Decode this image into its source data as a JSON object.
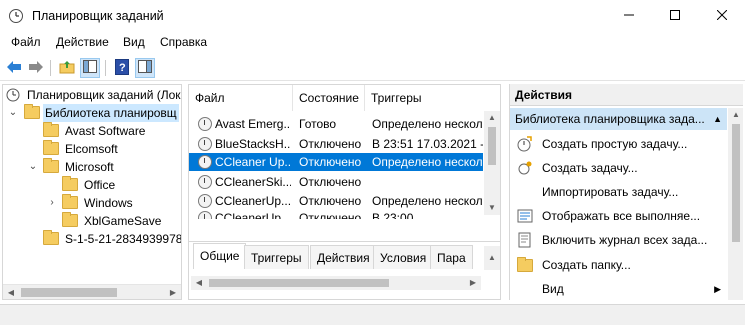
{
  "window": {
    "title": "Планировщик заданий",
    "icons": {
      "app": "task-scheduler-clock-icon",
      "minimize": "minimize-icon",
      "maximize": "maximize-icon",
      "close": "close-icon"
    }
  },
  "menu": [
    "Файл",
    "Действие",
    "Вид",
    "Справка"
  ],
  "toolbar": {
    "icons": [
      "back-arrow-icon",
      "forward-arrow-icon",
      "up-folder-icon",
      "show-hide-tree-icon",
      "help-icon",
      "show-hide-action-pane-icon"
    ]
  },
  "tree": {
    "root": "Планировщик заданий (Лок",
    "library": "Библиотека планировщ",
    "children": [
      {
        "label": "Avast Software"
      },
      {
        "label": "Elcomsoft"
      },
      {
        "label": "Microsoft"
      },
      {
        "label": "Office"
      },
      {
        "label": "Windows"
      },
      {
        "label": "XblGameSave"
      },
      {
        "label": "S-1-5-21-2834939978-"
      }
    ]
  },
  "tasks": {
    "columns": [
      "Файл",
      "Состояние",
      "Триггеры"
    ],
    "rows": [
      {
        "name": "Avast Emerg...",
        "state": "Готово",
        "trigger": "Определено нескол"
      },
      {
        "name": "BlueStacksH...",
        "state": "Отключено",
        "trigger": "В 23:51 17.03.2021 - '"
      },
      {
        "name": "CCleaner Up...",
        "state": "Отключено",
        "trigger": "Определено нескол"
      },
      {
        "name": "CCleanerSki...",
        "state": "Отключено",
        "trigger": ""
      },
      {
        "name": "CCleanerUp...",
        "state": "Отключено",
        "trigger": "Определено нескол"
      },
      {
        "name": "CCleanerUp...",
        "state": "Отключено",
        "trigger": "В 23:00"
      }
    ],
    "selected_index": 2
  },
  "detail_tabs": [
    "Общие",
    "Триггеры",
    "Действия",
    "Условия",
    "Пара"
  ],
  "actions": {
    "header": "Действия",
    "section": "Библиотека планировщика зада...",
    "items": [
      {
        "label": "Создать простую задачу...",
        "icon": "create-basic-task-icon"
      },
      {
        "label": "Создать задачу...",
        "icon": "create-task-icon"
      },
      {
        "label": "Импортировать задачу...",
        "icon": ""
      },
      {
        "label": "Отображать все выполняе...",
        "icon": "display-running-tasks-icon"
      },
      {
        "label": "Включить журнал всех зада...",
        "icon": "enable-history-icon"
      },
      {
        "label": "Создать папку...",
        "icon": "new-folder-icon"
      },
      {
        "label": "Вид",
        "icon": ""
      }
    ]
  }
}
